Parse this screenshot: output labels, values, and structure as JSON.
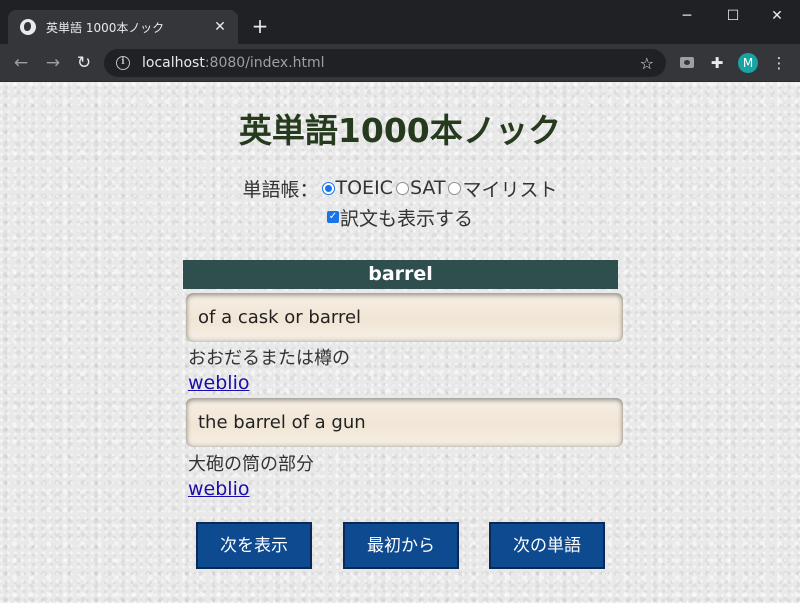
{
  "browser": {
    "tab_title": "英単語 1000本ノック",
    "tab_close": "✕",
    "new_tab": "+",
    "url_host": "localhost",
    "url_rest": ":8080/index.html",
    "profile_initial": "M",
    "window_controls": {
      "minimize": "─",
      "maximize": "☐",
      "close": "✕"
    }
  },
  "page": {
    "title": "英単語1000本ノック",
    "wordbook_label": "単語帳：",
    "wordbooks": [
      {
        "label": "TOEIC",
        "checked": true
      },
      {
        "label": "SAT",
        "checked": false
      },
      {
        "label": "マイリスト",
        "checked": false
      }
    ],
    "show_translation_label": "訳文も表示する",
    "show_translation_checked": true,
    "word": "barrel",
    "examples": [
      {
        "sentence": "of a cask or barrel",
        "translation": "おおだるまたは樽の",
        "link": "weblio"
      },
      {
        "sentence": "the barrel of a gun",
        "translation": "大砲の筒の部分",
        "link": "weblio"
      }
    ],
    "buttons": {
      "show": "次を表示",
      "restart": "最初から",
      "next_word": "次の単語"
    }
  },
  "colors": {
    "title": "#263a1e",
    "header_bg": "#2f4f4f",
    "button_bg": "#0d4a8f",
    "link": "#1a0dab"
  }
}
